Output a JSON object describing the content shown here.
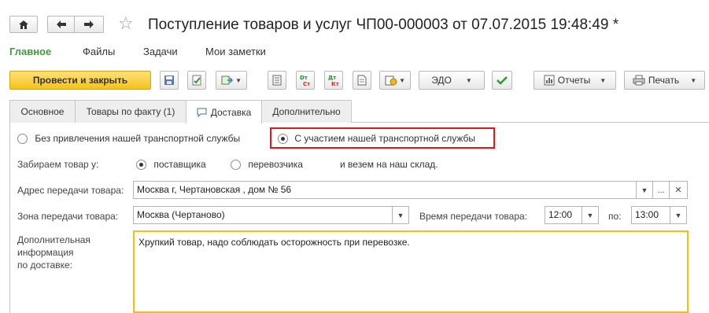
{
  "window": {
    "title": "Поступление товаров и услуг ЧП00-000003 от 07.07.2015 19:48:49 *"
  },
  "nav": {
    "home_icon": "home-icon",
    "back_icon": "arrow-left-icon",
    "forward_icon": "arrow-right-icon",
    "favorite_icon": "star-icon"
  },
  "menu": {
    "items": [
      "Главное",
      "Файлы",
      "Задачи",
      "Мои заметки"
    ],
    "active": "Главное"
  },
  "toolbar": {
    "post_close_label": "Провести и закрыть",
    "edo_label": "ЭДО",
    "reports_label": "Отчеты",
    "print_label": "Печать",
    "dt_ct_label_1": "Dт Ст",
    "dt_ct_label_2": "Дт Кт"
  },
  "tabs": [
    {
      "label": "Основное"
    },
    {
      "label": "Товары по факту (1)"
    },
    {
      "label": "Доставка"
    },
    {
      "label": "Дополнительно"
    }
  ],
  "delivery": {
    "option_no_transport": "Без привлечения нашей транспортной службы",
    "option_with_transport": "С участием нашей транспортной службы",
    "pickup_label": "Забираем товар у:",
    "pickup_supplier": "поставщика",
    "pickup_carrier": "перевозчика",
    "pickup_suffix": "и везем на наш склад.",
    "address_label": "Адрес передачи товара:",
    "address_value": "Москва г, Чертановская , дом № 56",
    "zone_label": "Зона передачи товара:",
    "zone_value": "Москва (Чертаново)",
    "time_label": "Время передачи товара:",
    "time_from": "12:00",
    "time_to_label": "по:",
    "time_to": "13:00",
    "extra_label_1": "Дополнительная",
    "extra_label_2": "информация",
    "extra_label_3": "по доставке:",
    "extra_value": "Хрупкий товар, надо соблюдать осторожность при перевозке."
  },
  "colors": {
    "accent_green": "#3a9e3a",
    "primary_button": "#f5c21a",
    "highlight_red": "#e0161a",
    "focus_yellow": "#f2c10e"
  }
}
